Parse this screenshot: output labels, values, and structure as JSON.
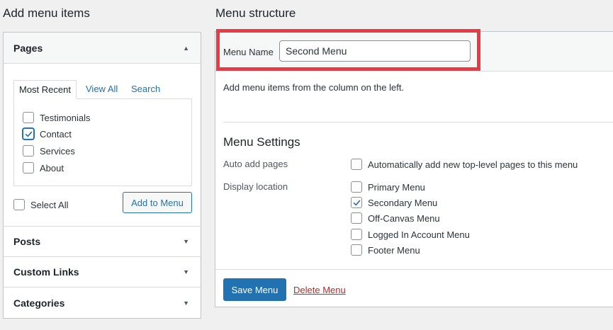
{
  "left": {
    "heading": "Add menu items",
    "sections": {
      "pages": {
        "title": "Pages",
        "tabs": [
          "Most Recent",
          "View All",
          "Search"
        ],
        "items": [
          {
            "label": "Testimonials",
            "checked": false
          },
          {
            "label": "Contact",
            "checked": true
          },
          {
            "label": "Services",
            "checked": false
          },
          {
            "label": "About",
            "checked": false
          }
        ],
        "select_all": "Select All",
        "add_button": "Add to Menu"
      },
      "posts": {
        "title": "Posts"
      },
      "custom_links": {
        "title": "Custom Links"
      },
      "categories": {
        "title": "Categories"
      }
    }
  },
  "right": {
    "heading": "Menu structure",
    "menu_name_label": "Menu Name",
    "menu_name_value": "Second Menu",
    "instructions": "Add menu items from the column on the left.",
    "settings_title": "Menu Settings",
    "auto_add_label": "Auto add pages",
    "auto_add_option": {
      "label": "Automatically add new top-level pages to this menu",
      "checked": false
    },
    "display_location_label": "Display location",
    "locations": [
      {
        "label": "Primary Menu",
        "checked": false
      },
      {
        "label": "Secondary Menu",
        "checked": true
      },
      {
        "label": "Off-Canvas Menu",
        "checked": false
      },
      {
        "label": "Logged In Account Menu",
        "checked": false
      },
      {
        "label": "Footer Menu",
        "checked": false
      }
    ],
    "save_button": "Save Menu",
    "delete_link": "Delete Menu"
  },
  "colors": {
    "accent": "#2271b1",
    "highlight": "#ea3a45",
    "danger": "#b32d2e"
  }
}
